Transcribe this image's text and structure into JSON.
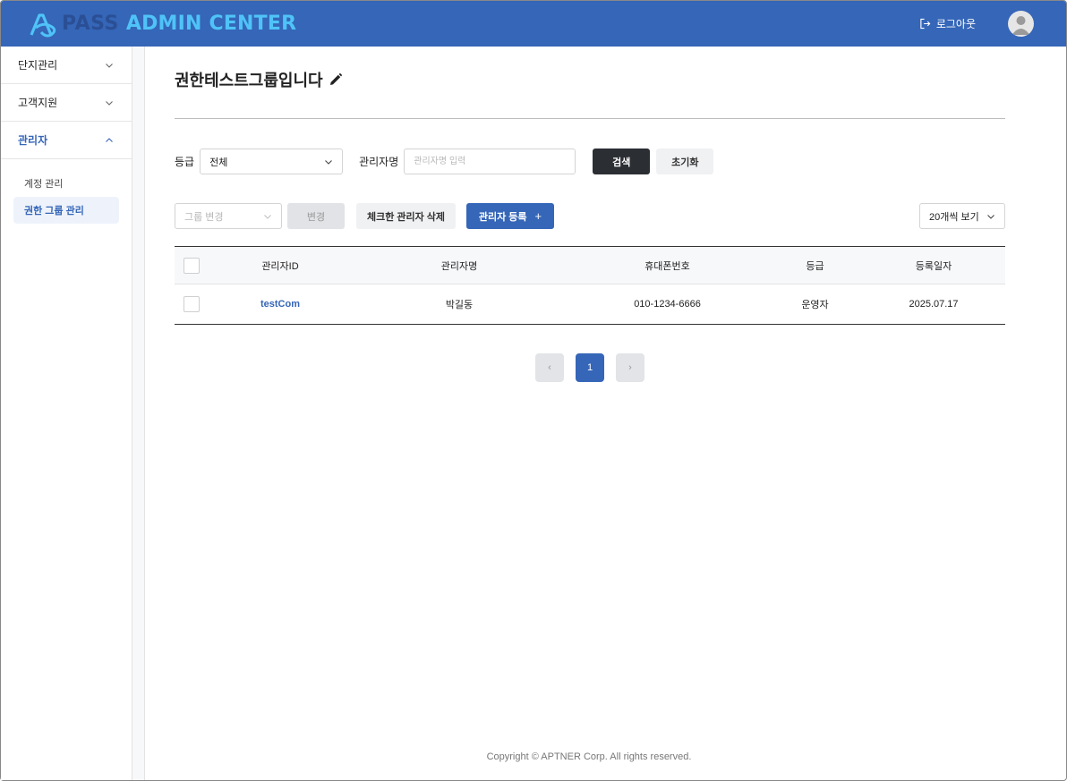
{
  "header": {
    "logo_pass": "PASS",
    "logo_admin": "ADMIN CENTER",
    "logout_label": "로그아웃",
    "colors": {
      "bar": "#3566b8",
      "logo_pass": "#2b4f95",
      "logo_admin": "#4fc3f7"
    }
  },
  "sidebar": {
    "groups": [
      {
        "label": "단지관리",
        "expanded": false
      },
      {
        "label": "고객지원",
        "expanded": false
      },
      {
        "label": "관리자",
        "expanded": true
      }
    ],
    "sub_items": [
      {
        "label": "계정 관리",
        "active": false
      },
      {
        "label": "권한 그룹 관리",
        "active": true
      }
    ]
  },
  "page": {
    "title": "권한테스트그룹입니다"
  },
  "filters": {
    "grade_label": "등급",
    "grade_value": "전체",
    "name_label": "관리자명",
    "name_placeholder": "관리자명 입력",
    "search_label": "검색",
    "reset_label": "초기화"
  },
  "actions": {
    "group_change_placeholder": "그룹 변경",
    "change_label": "변경",
    "delete_checked_label": "체크한 관리자 삭제",
    "register_label": "관리자 등록",
    "register_icon": "+",
    "rows_per_page": "20개씩 보기"
  },
  "table": {
    "headers": [
      "관리자ID",
      "관리자명",
      "휴대폰번호",
      "등급",
      "등록일자"
    ],
    "rows": [
      {
        "id": "testCom",
        "name": "박길동",
        "phone": "010-1234-6666",
        "grade": "운영자",
        "date": "2025.07.17"
      }
    ]
  },
  "pagination": {
    "prev": "‹",
    "current": "1",
    "next": "›"
  },
  "footer": {
    "copyright": "Copyright © APTNER Corp. All rights reserved."
  }
}
